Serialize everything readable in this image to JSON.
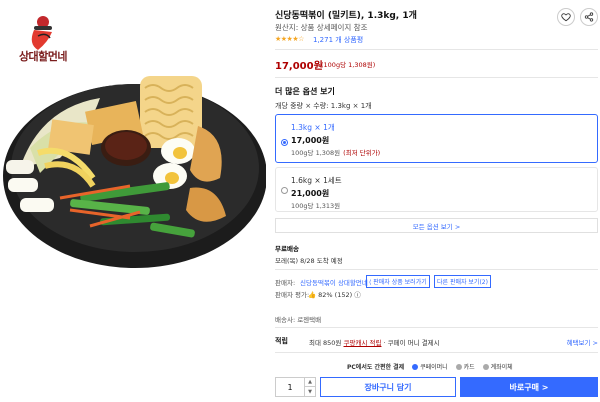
{
  "brand": {
    "logo_text": "상대할먼네"
  },
  "product": {
    "title": "신당동떡볶이 (밀키트), 1.3kg, 1개",
    "origin": "원산지: 상품 상세페이지 참조",
    "rating_stars": "★★★★☆",
    "rating": 4,
    "review_count": "1,271 개 상품평",
    "price": "17,000원",
    "unit_price": "(100g당 1,308원)"
  },
  "options": {
    "heading": "더 많은 옵션 보기",
    "summary": "개당 중량 × 수량: 1.3kg × 1개",
    "items": [
      {
        "name": "1.3kg × 1개",
        "price": "17,000원",
        "unit": "100g당 1,308원",
        "badge": "(최저 단위가)",
        "selected": true
      },
      {
        "name": "1.6kg × 1세트",
        "price": "21,000원",
        "unit": "100g당 1,313원",
        "badge": "",
        "selected": false
      }
    ],
    "view_all": "모든 옵션 보기 >"
  },
  "shipping": {
    "label": "무료배송",
    "eta": "모레(목) 8/28 도착 예정"
  },
  "seller": {
    "label": "판매자:",
    "name": "신당동떡볶이 상대할먼네",
    "link1": "판매자 상품 보러가기",
    "link2": "다른 판매자 보기(2)",
    "rating_label": "판매자 평가:",
    "rating_value": "👍 82% (152) ⓘ",
    "carrier": "배송사: 로젠택배"
  },
  "payment": {
    "label": "적립",
    "text_prefix": "최대 850원",
    "cash": "쿠팡캐시 적립",
    "text_suffix": "· 쿠페이 머니 결제시",
    "more": "혜택보기 >",
    "easy_pay": "PC에서도 간편한 결제",
    "methods": [
      "쿠페이머니",
      "카드",
      "계좌이체"
    ]
  },
  "purchase": {
    "quantity": "1",
    "qty_up": "▲",
    "qty_down": "▼",
    "cart": "장바구니 담기",
    "buy": "바로구매 >"
  },
  "colors": {
    "accent": "#346aff",
    "price": "#ae0000",
    "star": "#f5a623"
  }
}
